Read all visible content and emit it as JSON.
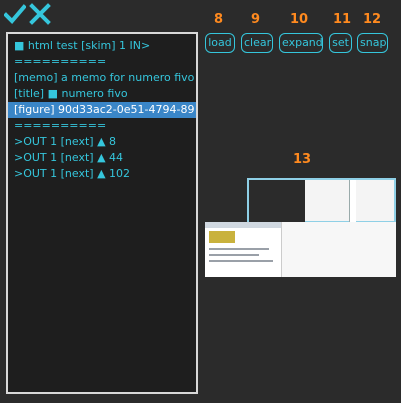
{
  "toolbar": {
    "check_icon": "check-icon",
    "close_icon": "close-icon"
  },
  "list": {
    "items": [
      "■ html test [skim] 1 IN>",
      "==========",
      "[memo] a memo for numero fivo",
      "[title] ■ numero fivo",
      "[figure] 90d33ac2-0e51-4794-89",
      "==========",
      ">OUT 1 [next] ▲ 8",
      ">OUT 1 [next] ▲ 44",
      ">OUT 1 [next] ▲ 102"
    ],
    "selected_index": 4
  },
  "buttons": {
    "load": {
      "number": "8",
      "label": "load"
    },
    "clear": {
      "number": "9",
      "label": "clear"
    },
    "expand": {
      "number": "10",
      "label": "expand"
    },
    "set": {
      "number": "11",
      "label": "set"
    },
    "snap": {
      "number": "12",
      "label": "snap"
    }
  },
  "snapshot": {
    "number": "13"
  },
  "colors": {
    "accent": "#35c6dc",
    "label": "#ff8a1f",
    "background": "#2b2b2b",
    "selection": "#3a86c8"
  }
}
